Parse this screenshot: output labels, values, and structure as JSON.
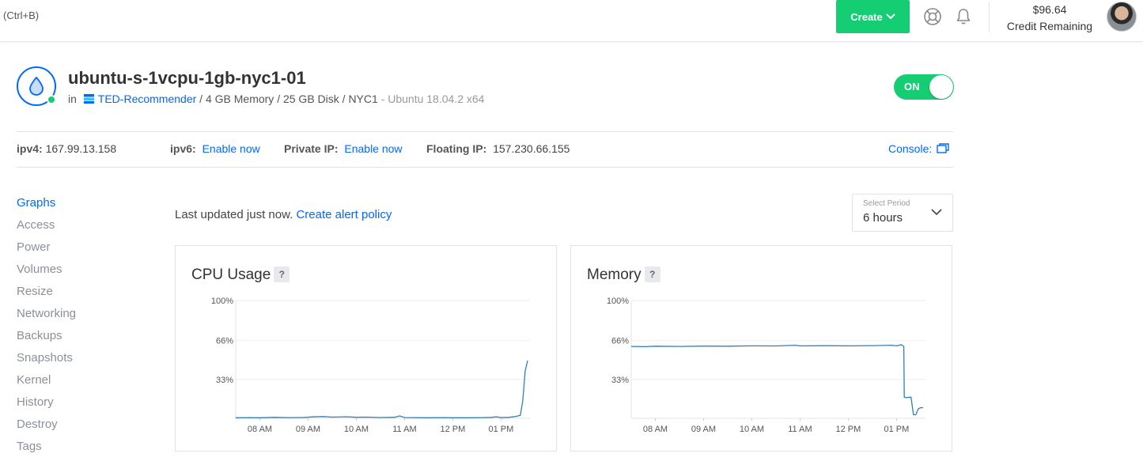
{
  "topbar": {
    "shortcut_hint": "(Ctrl+B)",
    "create_label": "Create",
    "credit_amount": "$96.64",
    "credit_label": "Credit Remaining",
    "icons": [
      "help-icon",
      "bell-icon",
      "avatar"
    ]
  },
  "droplet": {
    "name": "ubuntu-s-1vcpu-1gb-nyc1-01",
    "in_label": "in",
    "project": "TED-Recommender",
    "specs": "/ 4 GB Memory / 25 GB Disk / NYC1",
    "os": "- Ubuntu 18.04.2 x64",
    "power_label": "ON",
    "status_color": "#15cd72"
  },
  "network": {
    "ipv4_label": "ipv4:",
    "ipv4_value": "167.99.13.158",
    "ipv6_label": "ipv6:",
    "ipv6_link": "Enable now",
    "private_label": "Private IP:",
    "private_link": "Enable now",
    "floating_label": "Floating IP:",
    "floating_value": "157.230.66.155",
    "console_label": "Console:"
  },
  "sidebar": {
    "items": [
      {
        "label": "Graphs",
        "active": true
      },
      {
        "label": "Access"
      },
      {
        "label": "Power"
      },
      {
        "label": "Volumes"
      },
      {
        "label": "Resize"
      },
      {
        "label": "Networking"
      },
      {
        "label": "Backups"
      },
      {
        "label": "Snapshots"
      },
      {
        "label": "Kernel"
      },
      {
        "label": "History"
      },
      {
        "label": "Destroy"
      },
      {
        "label": "Tags"
      }
    ]
  },
  "graphs": {
    "last_updated": "Last updated just now.",
    "alert_link": "Create alert policy",
    "period_label": "Select Period",
    "period_value": "6 hours",
    "help_mark": "?"
  },
  "accent_color": "#0069ff",
  "chart_data": [
    {
      "type": "line",
      "title": "CPU Usage",
      "xlabel": "",
      "ylabel": "",
      "y_ticks": [
        "100%",
        "66%",
        "33%"
      ],
      "x_ticks": [
        "08 AM",
        "09 AM",
        "10 AM",
        "11 AM",
        "12 PM",
        "01 PM"
      ],
      "ylim": [
        0,
        100
      ],
      "xlim": [
        7.5,
        13.6
      ],
      "grid": true,
      "series": [
        {
          "color": "#2f7fb8",
          "x": [
            7.5,
            7.8,
            8.0,
            8.3,
            8.6,
            8.9,
            9.1,
            9.3,
            9.5,
            9.8,
            10.0,
            10.2,
            10.5,
            10.8,
            10.9,
            11.0,
            11.2,
            11.5,
            11.8,
            12.0,
            12.3,
            12.6,
            12.8,
            12.9,
            13.0,
            13.15,
            13.3,
            13.4,
            13.45,
            13.5,
            13.55
          ],
          "y": [
            0.5,
            0.6,
            0.5,
            0.8,
            0.6,
            0.7,
            1.2,
            1.5,
            1.0,
            1.3,
            0.9,
            1.0,
            0.7,
            0.9,
            2.0,
            0.7,
            0.6,
            0.5,
            0.6,
            0.5,
            0.5,
            0.6,
            0.8,
            1.2,
            0.7,
            0.8,
            1.5,
            2.5,
            15,
            40,
            49
          ]
        }
      ]
    },
    {
      "type": "line",
      "title": "Memory",
      "xlabel": "",
      "ylabel": "",
      "y_ticks": [
        "100%",
        "66%",
        "33%"
      ],
      "x_ticks": [
        "08 AM",
        "09 AM",
        "10 AM",
        "11 AM",
        "12 PM",
        "01 PM"
      ],
      "ylim": [
        0,
        100
      ],
      "xlim": [
        7.5,
        13.6
      ],
      "grid": true,
      "series": [
        {
          "color": "#2f7fb8",
          "x": [
            7.5,
            7.8,
            8.0,
            8.5,
            9.0,
            9.5,
            10.0,
            10.5,
            10.9,
            11.0,
            11.5,
            12.0,
            12.5,
            12.9,
            13.0,
            13.1,
            13.15,
            13.16,
            13.2,
            13.3,
            13.35,
            13.4,
            13.45,
            13.5,
            13.55
          ],
          "y": [
            61,
            60.8,
            61.2,
            61,
            61.3,
            61.2,
            61.5,
            61.4,
            62,
            61.5,
            61.6,
            61.5,
            61.7,
            62,
            61.5,
            62.5,
            61,
            18,
            17.5,
            18,
            3,
            3,
            8,
            9,
            9
          ]
        }
      ]
    }
  ]
}
